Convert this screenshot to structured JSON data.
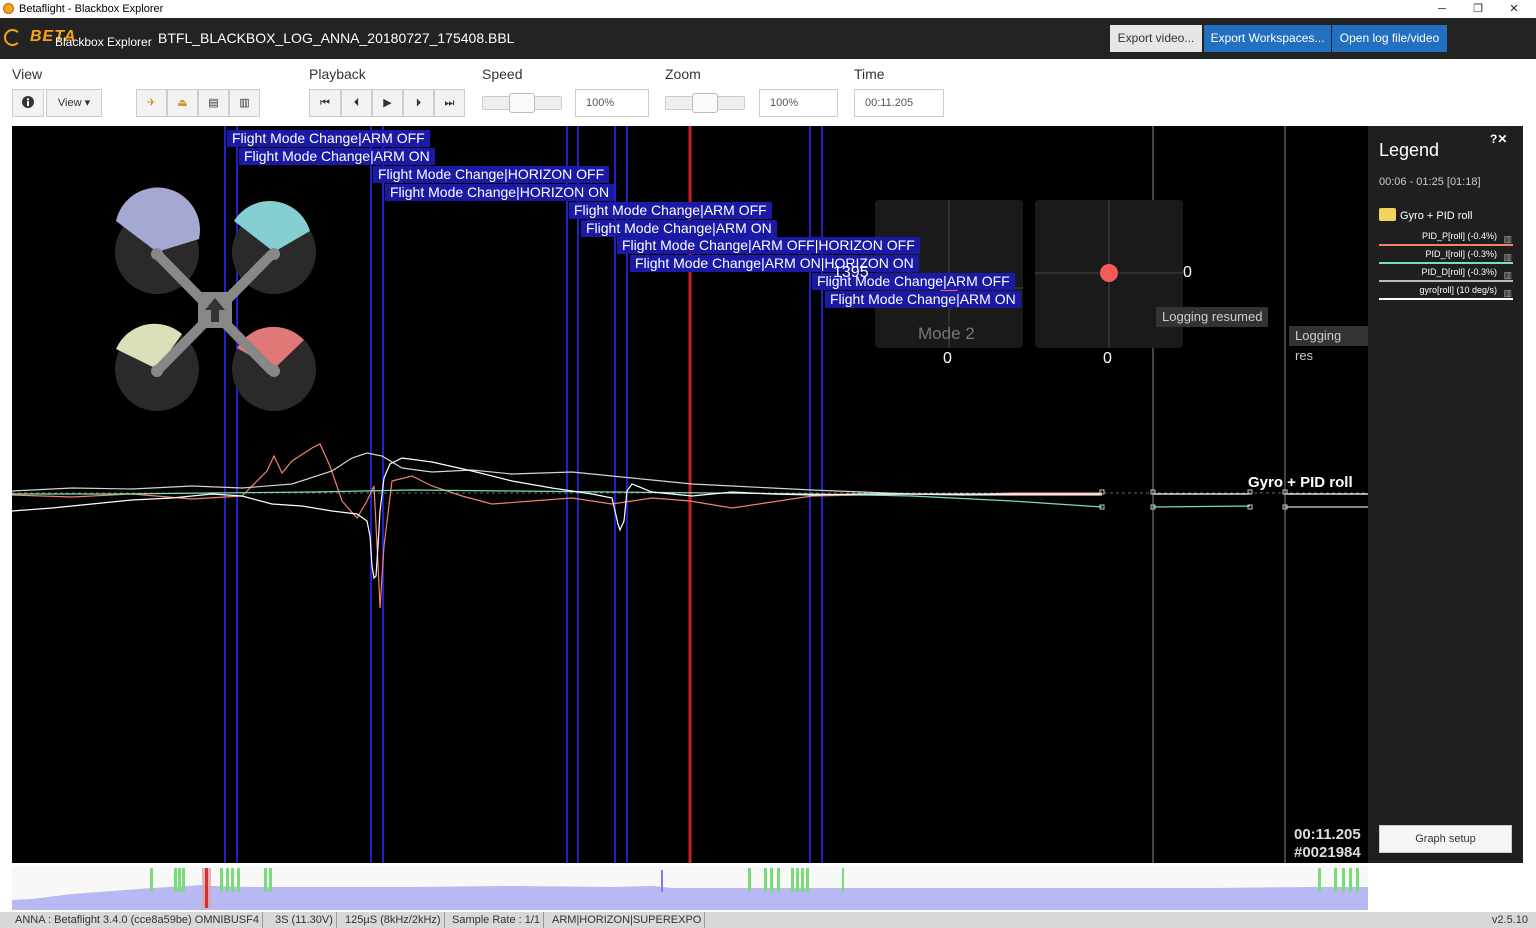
{
  "window": {
    "title": "Betaflight - Blackbox Explorer",
    "minimize": "─",
    "restore": "❐",
    "close": "✕"
  },
  "header": {
    "logo_main": "BETA",
    "logo_sub": "Blackbox Explorer",
    "file_name": "BTFL_BLACKBOX_LOG_ANNA_20180727_175408.BBL",
    "export_video": "Export video...",
    "export_workspaces": "Export Workspaces...",
    "open_log": "Open log file/video"
  },
  "toolbar": {
    "view_label": "View",
    "info_icon": "info-icon",
    "view_button": "View ▾",
    "playback_label": "Playback",
    "speed_label": "Speed",
    "speed_value": "100%",
    "zoom_label": "Zoom",
    "zoom_value": "100%",
    "time_label": "Time",
    "time_value": "00:11.205"
  },
  "events": [
    "Flight Mode Change|ARM OFF",
    "Flight Mode Change|ARM ON",
    "Flight Mode Change|HORIZON OFF",
    "Flight Mode Change|HORIZON ON",
    "Flight Mode Change|ARM OFF",
    "Flight Mode Change|ARM ON",
    "Flight Mode Change|ARM OFF|HORIZON OFF",
    "Flight Mode Change|ARM ON|HORIZON ON",
    "Flight Mode Change|ARM OFF",
    "Flight Mode Change|ARM ON"
  ],
  "sticks": {
    "left_top_value": "1395",
    "left_bottom_value": "0",
    "mode_label": "Mode 2",
    "right_side_value": "0",
    "right_bottom_value": "0"
  },
  "tooltips": {
    "logging_resumed_1": "Logging resumed",
    "logging_resumed_2": "Logging res"
  },
  "graph": {
    "graph_label": "Gyro + PID roll",
    "time_readout": "00:11.205",
    "frame_readout": "#0021984",
    "colors": {
      "pid_p": "#f38269",
      "pid_i": "#78e2af",
      "pid_d": "#d4d3d3",
      "gyro": "#ffffff",
      "event_line": "#2020d0",
      "cursor_line": "#c82020"
    }
  },
  "legend": {
    "title": "Legend",
    "close": "?✕",
    "range": "00:06 - 01:25 [01:18]",
    "group": "Gyro + PID roll",
    "items": [
      {
        "label": "PID_P[roll] (-0.4%)",
        "color": "#f38269"
      },
      {
        "label": "PID_I[roll] (-0.3%)",
        "color": "#78e2af"
      },
      {
        "label": "PID_D[roll] (-0.3%)",
        "color": "#bbbbbb"
      },
      {
        "label": "gyro[roll] (10 deg/s)",
        "color": "#ffffff"
      }
    ],
    "graph_setup": "Graph setup"
  },
  "status": {
    "craft": "ANNA : Betaflight 3.4.0 (cce8a59be) OMNIBUSF4",
    "battery": "3S (11.30V)",
    "looptime": "125µS (8kHz/2kHz)",
    "sample_rate": "Sample Rate : 1/1",
    "modes": "ARM|HORIZON|SUPEREXPO",
    "version": "v2.5.10"
  }
}
